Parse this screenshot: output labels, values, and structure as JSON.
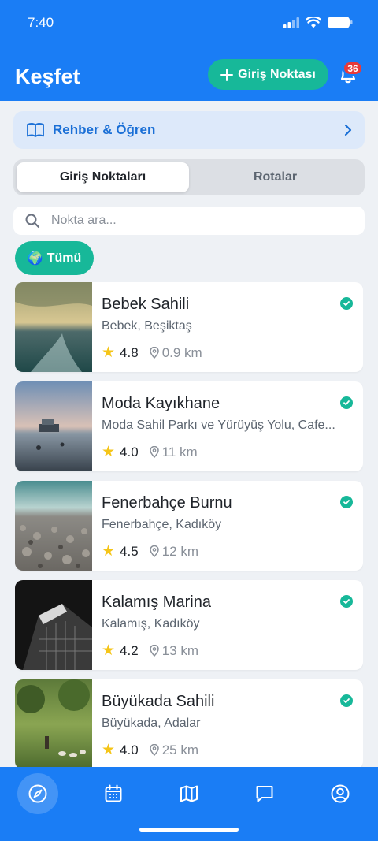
{
  "status_bar": {
    "time": "7:40"
  },
  "header": {
    "title": "Keşfet",
    "add_button_label": "Giriş Noktası",
    "notification_count": "36"
  },
  "guide": {
    "label": "Rehber & Öğren"
  },
  "segments": [
    {
      "label": "Giriş Noktaları",
      "active": true
    },
    {
      "label": "Rotalar",
      "active": false
    }
  ],
  "search": {
    "placeholder": "Nokta ara..."
  },
  "filter_chip": {
    "emoji": "🌍",
    "label": "Tümü"
  },
  "spots": [
    {
      "name": "Bebek Sahili",
      "location": "Bebek, Beşiktaş",
      "rating": "4.8",
      "distance": "0.9 km",
      "verified": true
    },
    {
      "name": "Moda Kayıkhane",
      "location": "Moda Sahil Parkı ve Yürüyüş Yolu, Cafe...",
      "rating": "4.0",
      "distance": "11 km",
      "verified": true
    },
    {
      "name": "Fenerbahçe Burnu",
      "location": "Fenerbahçe, Kadıköy",
      "rating": "4.5",
      "distance": "12 km",
      "verified": true
    },
    {
      "name": "Kalamış Marina",
      "location": "Kalamış, Kadıköy",
      "rating": "4.2",
      "distance": "13 km",
      "verified": true
    },
    {
      "name": "Büyükada Sahili",
      "location": "Büyükada, Adalar",
      "rating": "4.0",
      "distance": "25 km",
      "verified": true
    }
  ],
  "tabbar": [
    {
      "icon": "compass-icon",
      "active": true
    },
    {
      "icon": "calendar-icon",
      "active": false
    },
    {
      "icon": "map-icon",
      "active": false
    },
    {
      "icon": "chat-icon",
      "active": false
    },
    {
      "icon": "profile-icon",
      "active": false
    }
  ],
  "colors": {
    "primary": "#1a7df5",
    "accent": "#17b899",
    "badge": "#e83a3a"
  }
}
